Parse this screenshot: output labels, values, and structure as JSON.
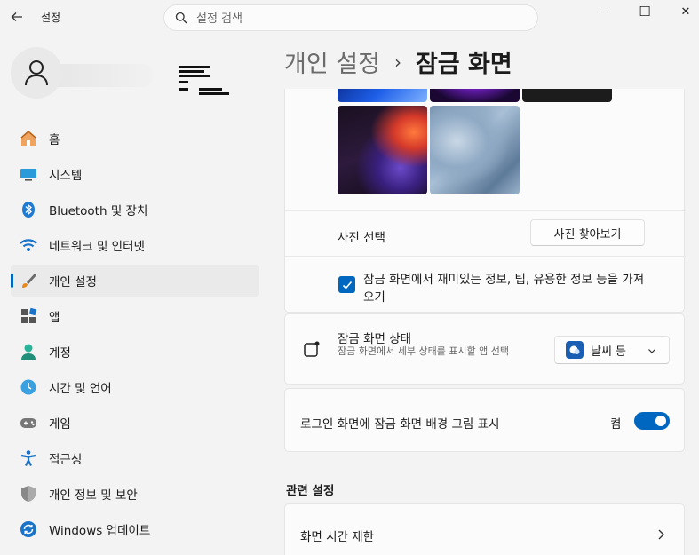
{
  "titlebar": {
    "app_title": "설정",
    "search_placeholder": "설정 검색",
    "minimize_glyph": "—",
    "maximize_glyph": "☐",
    "close_glyph": "✕"
  },
  "sidebar": {
    "items": [
      {
        "label": "홈",
        "icon": "home-icon"
      },
      {
        "label": "시스템",
        "icon": "system-icon"
      },
      {
        "label": "Bluetooth 및 장치",
        "icon": "bluetooth-icon"
      },
      {
        "label": "네트워크 및 인터넷",
        "icon": "network-icon"
      },
      {
        "label": "개인 설정",
        "icon": "brush-icon",
        "active": true
      },
      {
        "label": "앱",
        "icon": "apps-icon"
      },
      {
        "label": "계정",
        "icon": "account-icon"
      },
      {
        "label": "시간 및 언어",
        "icon": "time-language-icon"
      },
      {
        "label": "게임",
        "icon": "gaming-icon"
      },
      {
        "label": "접근성",
        "icon": "accessibility-icon"
      },
      {
        "label": "개인 정보 및 보안",
        "icon": "shield-icon"
      },
      {
        "label": "Windows 업데이트",
        "icon": "update-icon"
      }
    ]
  },
  "header": {
    "parent": "개인 설정",
    "separator": "›",
    "current": "잠금 화면"
  },
  "picture_card": {
    "choose_photo_label": "사진 선택",
    "browse_button": "사진 찾아보기",
    "fun_facts_label": "잠금 화면에서 재미있는 정보, 팁, 유용한 정보 등을 가져오기",
    "fun_facts_checked": true
  },
  "status_card": {
    "title": "잠금 화면 상태",
    "subtitle": "잠금 화면에서 세부 상태를 표시할 앱 선택",
    "dropdown_value": "날씨 등"
  },
  "signin_card": {
    "label": "로그인 화면에 잠금 화면 배경 그림 표시",
    "toggle_state": "켬",
    "toggle_on": true
  },
  "related": {
    "title": "관련 설정",
    "items": [
      {
        "label": "화면 시간 제한"
      }
    ]
  },
  "colors": {
    "accent": "#0067c0",
    "background": "#f3f3f3",
    "card": "#fbfbfb"
  }
}
